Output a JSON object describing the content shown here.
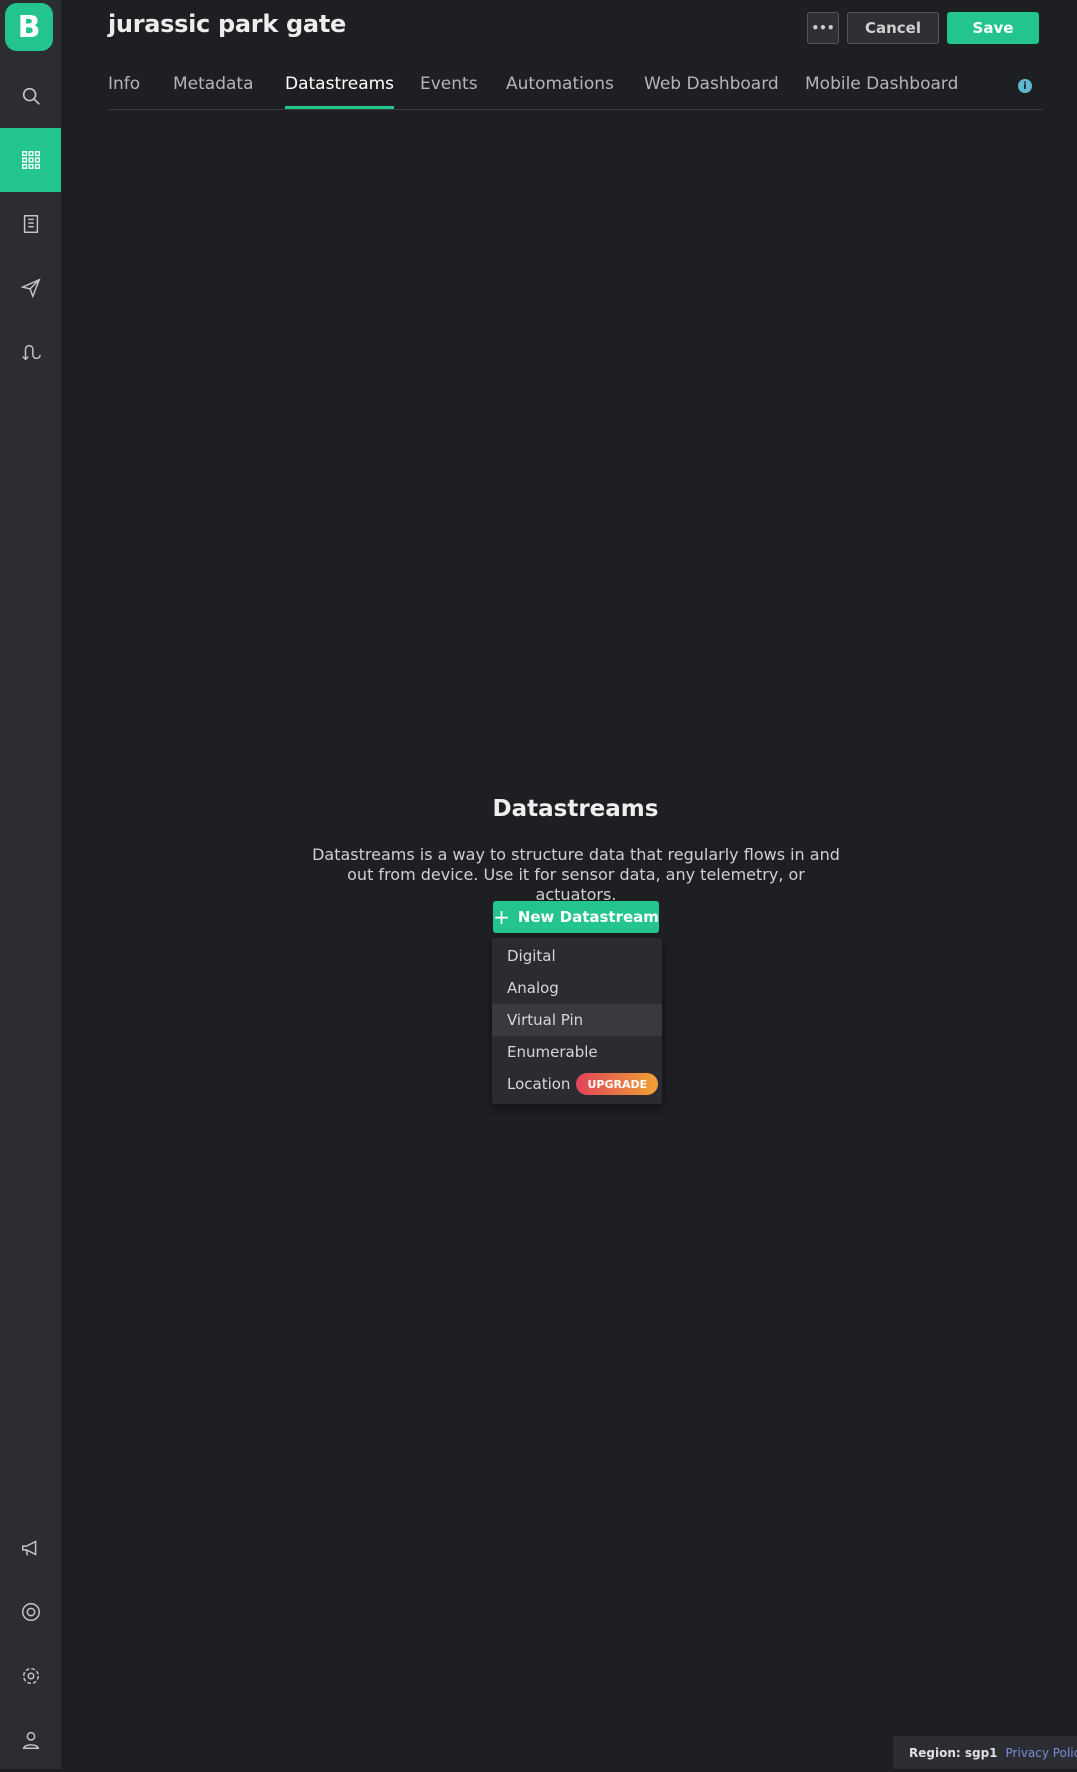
{
  "app": {
    "logo_letter": "B",
    "brand_color": "#23c48e"
  },
  "sidebar": {
    "items": [
      {
        "icon": "search-icon",
        "active": false
      },
      {
        "icon": "grid-icon",
        "active": true
      },
      {
        "icon": "building-icon",
        "active": false
      },
      {
        "icon": "paper-plane-icon",
        "active": false
      },
      {
        "icon": "flow-arrows-icon",
        "active": false
      }
    ],
    "bottom_items": [
      {
        "icon": "megaphone-icon"
      },
      {
        "icon": "lifebuoy-icon"
      },
      {
        "icon": "gear-icon"
      },
      {
        "icon": "user-icon"
      }
    ]
  },
  "header": {
    "title": "jurassic park gate",
    "more_label": "•••",
    "cancel_label": "Cancel",
    "save_label": "Save"
  },
  "tabs": [
    {
      "label": "Info"
    },
    {
      "label": "Metadata"
    },
    {
      "label": "Datastreams",
      "active": true
    },
    {
      "label": "Events"
    },
    {
      "label": "Automations"
    },
    {
      "label": "Web Dashboard"
    },
    {
      "label": "Mobile Dashboard"
    }
  ],
  "info_icon_text": "i",
  "empty_state": {
    "title": "Datastreams",
    "description": "Datastreams is a way to structure data that regularly flows in and out from device. Use it for sensor data, any telemetry, or actuators.",
    "button_icon": "+",
    "button_label": "New Datastream"
  },
  "dropdown": {
    "items": [
      {
        "label": "Digital"
      },
      {
        "label": "Analog"
      },
      {
        "label": "Virtual Pin",
        "hover": true
      },
      {
        "label": "Enumerable"
      },
      {
        "label": "Location",
        "badge": "UPGRADE"
      }
    ]
  },
  "footer": {
    "region": "Region: sgp1",
    "privacy": "Privacy Policy"
  }
}
